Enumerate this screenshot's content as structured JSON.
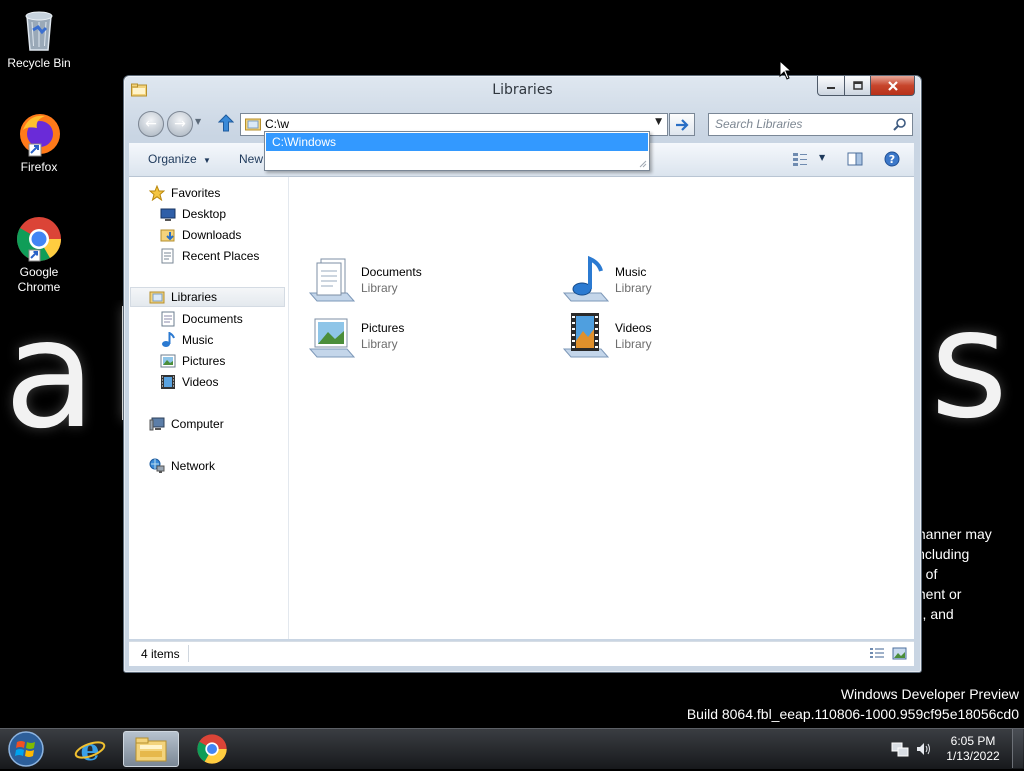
{
  "desktop": {
    "icons": [
      {
        "label": "Recycle Bin"
      },
      {
        "label": "Firefox"
      },
      {
        "label": "Google Chrome"
      }
    ],
    "wallpaper_paragraph": [
      "manner may",
      "including",
      "e of",
      "ment or",
      "f), and"
    ],
    "watermark": {
      "line1": "Windows Developer Preview",
      "line2": "Build 8064.fbl_eeap.110806-1000.959cf95e18056cd0"
    }
  },
  "window": {
    "title": "Libraries",
    "address_value": "C:\\w",
    "search_placeholder": "Search Libraries",
    "autocomplete": [
      "C:\\Windows"
    ],
    "toolbar": {
      "organize": "Organize",
      "new": "New"
    },
    "nav": {
      "favorites": "Favorites",
      "desktop": "Desktop",
      "downloads": "Downloads",
      "recent_places": "Recent Places",
      "libraries": "Libraries",
      "documents": "Documents",
      "music": "Music",
      "pictures": "Pictures",
      "videos": "Videos",
      "computer": "Computer",
      "network": "Network"
    },
    "items": [
      {
        "name": "Documents",
        "type": "Library"
      },
      {
        "name": "Music",
        "type": "Library"
      },
      {
        "name": "Pictures",
        "type": "Library"
      },
      {
        "name": "Videos",
        "type": "Library"
      }
    ],
    "status": "4 items"
  },
  "taskbar": {
    "time": "6:05 PM",
    "date": "1/13/2022"
  },
  "colors": {
    "selection": "#3399ff",
    "close_button": "#c7452c",
    "desktop_bg": "#000000"
  }
}
